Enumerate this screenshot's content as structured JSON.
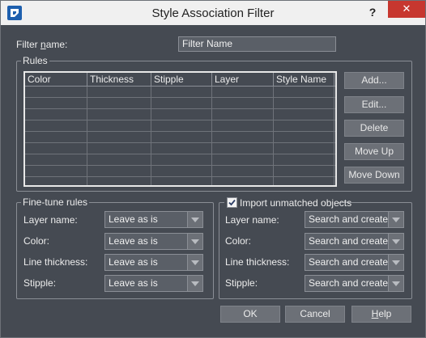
{
  "window": {
    "title": "Style Association Filter",
    "help_glyph": "?",
    "close_glyph": "✕"
  },
  "filter": {
    "name_label_pre": "Filter ",
    "name_label_accel": "n",
    "name_label_post": "ame:",
    "name_value": "Filter Name"
  },
  "rules": {
    "title": "Rules",
    "columns": [
      "Color",
      "Thickness",
      "Stipple",
      "Layer",
      "Style Name"
    ],
    "rows": []
  },
  "side_buttons": {
    "add": "Add...",
    "edit": "Edit...",
    "delete": "Delete",
    "move_up": "Move Up",
    "move_down": "Move Down"
  },
  "fine_tune": {
    "title": "Fine-tune rules",
    "layer_label": "Layer name:",
    "color_label": "Color:",
    "thickness_label": "Line thickness:",
    "stipple_label": "Stipple:",
    "layer_value": "Leave as is",
    "color_value": "Leave as is",
    "thickness_value": "Leave as is",
    "stipple_value": "Leave as is"
  },
  "import": {
    "title": "Import unmatched objects",
    "checked": true,
    "layer_label": "Layer name:",
    "color_label": "Color:",
    "thickness_label": "Line thickness:",
    "stipple_label": "Stipple:",
    "layer_value": "Search and create ch",
    "color_value": "Search and create ch",
    "thickness_value": "Search and create ch",
    "stipple_value": "Search and create ch"
  },
  "footer": {
    "ok": "OK",
    "cancel": "Cancel",
    "help_accel": "H",
    "help_rest": "elp"
  },
  "colors": {
    "dialog_bg": "#454a52",
    "button_bg": "#6c7077",
    "close_red": "#c7372f",
    "brand_blue": "#1d5fae"
  }
}
